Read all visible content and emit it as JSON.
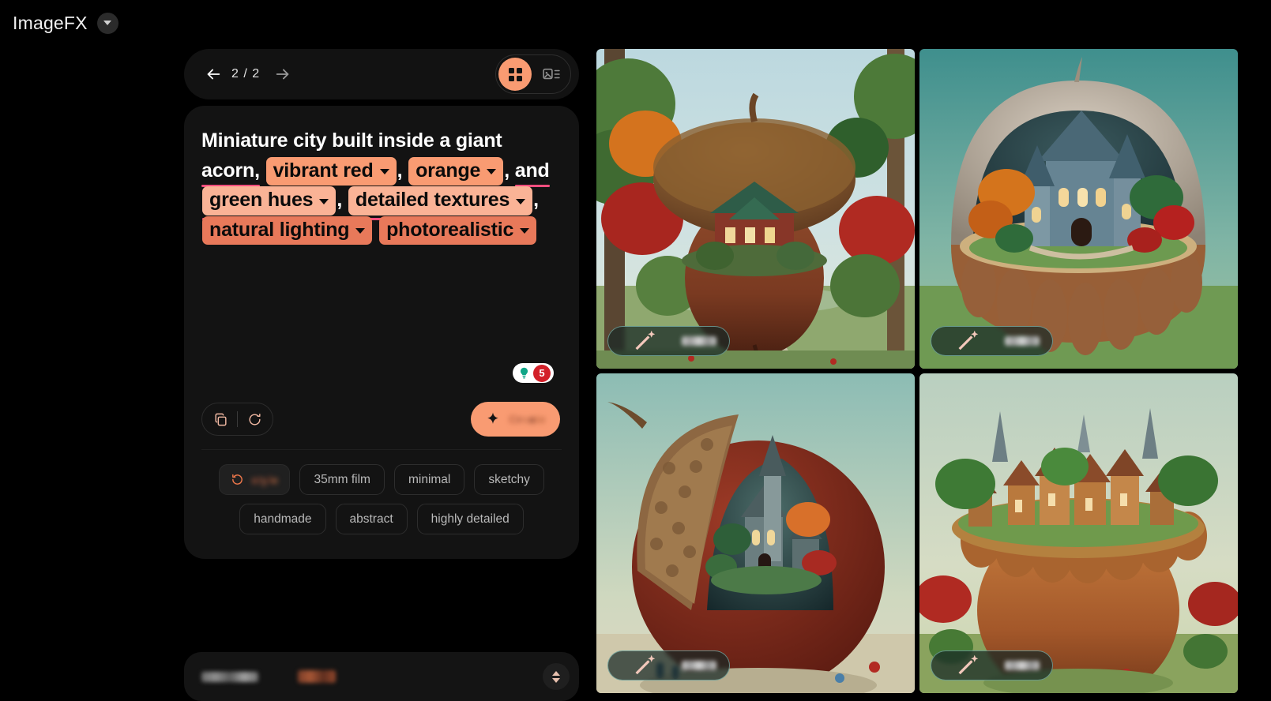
{
  "app": {
    "brand_title": "ImageFX",
    "brand_caret_icon": "chevron-down-icon"
  },
  "navbar": {
    "back_icon": "arrow-left-icon",
    "forward_icon": "arrow-right-icon",
    "page_count": "2 / 2",
    "view_grid_icon": "grid-view-icon",
    "view_list_icon": "image-list-view-icon"
  },
  "prompt": {
    "segments": [
      {
        "type": "text",
        "value": "Miniature city built inside a giant acorn,",
        "underline": true
      },
      {
        "type": "chip",
        "value": "vibrant red",
        "color": "#F99B72",
        "underline": false,
        "caret_icon": "chevron-down-icon"
      },
      {
        "type": "text",
        "value": ",",
        "underline": false
      },
      {
        "type": "chip",
        "value": "orange",
        "color": "#F99B72",
        "underline": true,
        "caret_icon": "chevron-down-icon"
      },
      {
        "type": "text",
        "value": ",",
        "underline": false
      },
      {
        "type": "text",
        "value": "and",
        "underline": true
      },
      {
        "type": "chip",
        "value": "green hues",
        "color": "#FAB396",
        "underline": true,
        "caret_icon": "chevron-down-icon"
      },
      {
        "type": "text",
        "value": ",",
        "underline": false
      },
      {
        "type": "chip",
        "value": "detailed textures",
        "color": "#FAB396",
        "underline": true,
        "caret_icon": "chevron-down-icon"
      },
      {
        "type": "text",
        "value": ",",
        "underline": false
      },
      {
        "type": "chip",
        "value": "natural lighting",
        "color": "#E8795A",
        "underline": false,
        "caret_icon": "chevron-down-icon"
      },
      {
        "type": "chip",
        "value": "photorealistic",
        "color": "#E8795A",
        "underline": false,
        "caret_icon": "chevron-down-icon"
      }
    ],
    "underline_color": "#FF4E7E"
  },
  "hint": {
    "bulb_icon": "lightbulb-icon",
    "count": "5",
    "badge_color": "#D32029",
    "bulb_color": "#0FA687"
  },
  "actions": {
    "copy_icon": "copy-icon",
    "reroll_icon": "refresh-icon",
    "generate_icon": "sparkle-icon",
    "generate_label": "",
    "generate_color": "#F99B72"
  },
  "styles": {
    "row1": [
      {
        "label": "",
        "icon": "refresh-icon",
        "primary": true
      },
      {
        "label": "35mm film",
        "primary": false
      },
      {
        "label": "minimal",
        "primary": false
      },
      {
        "label": "sketchy",
        "primary": false
      }
    ],
    "row2": [
      {
        "label": "handmade",
        "primary": false
      },
      {
        "label": "abstract",
        "primary": false
      },
      {
        "label": "highly detailed",
        "primary": false
      }
    ]
  },
  "bottombar": {
    "label": "",
    "value": "",
    "stepper_icon": "chevron-up-down-icon"
  },
  "grid": {
    "tiles": [
      {
        "name": "generated-image-1",
        "alt": "Acorn house in autumn forest",
        "pill_icon": "magic-wand-icon",
        "pill_label": ""
      },
      {
        "name": "generated-image-2",
        "alt": "Castle inside open acorn shell",
        "pill_icon": "magic-wand-icon",
        "pill_label": ""
      },
      {
        "name": "generated-image-3",
        "alt": "Village inside cracked acorn",
        "pill_icon": "magic-wand-icon",
        "pill_label": ""
      },
      {
        "name": "generated-image-4",
        "alt": "Town atop giant acorn",
        "pill_icon": "magic-wand-icon",
        "pill_label": ""
      }
    ]
  }
}
